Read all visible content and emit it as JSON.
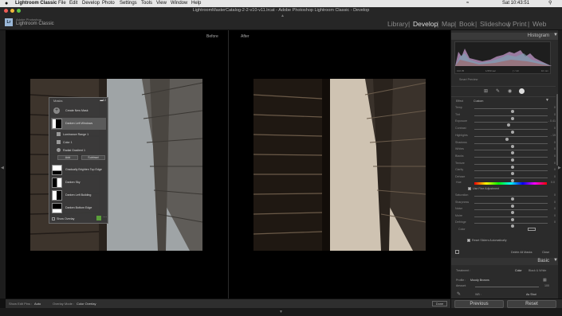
{
  "macbar": {
    "apple": "",
    "app": "Lightroom Classic",
    "menus": [
      "File",
      "Edit",
      "Develop",
      "Photo",
      "Settings",
      "Tools",
      "View",
      "Window",
      "Help"
    ],
    "clock": "Sat 10:43:51"
  },
  "window_title": "LightroomMasterCatalog-2-2-v10-v11.lrcat - Adobe Photoshop Lightroom Classic - Develop",
  "brand": {
    "line1": "Adobe Photoshop",
    "line2": "Lightroom Classic"
  },
  "modules": [
    {
      "label": "Library"
    },
    {
      "label": "Develop"
    },
    {
      "label": "Map"
    },
    {
      "label": "Book"
    },
    {
      "label": "Slideshow"
    },
    {
      "label": "Print"
    },
    {
      "label": "Web"
    }
  ],
  "module_sep": "|",
  "view": {
    "before": "Before",
    "after": "After"
  },
  "masks": {
    "title": "Masks",
    "create": "Create New Mask",
    "mask_name": "Darken Left Windows",
    "components": [
      "Luminance Range 1",
      "Color 1",
      "Radial Gradient 1"
    ],
    "add": "Add",
    "subtract": "Subtract",
    "others": [
      "Gradually Brighten Top Edge",
      "Darken Sky",
      "Darken Left Building",
      "Darken Bottom Edge"
    ],
    "show_overlay": "Show Overlay"
  },
  "histogram": {
    "title": "Histogram",
    "readout": [
      "102.35",
      "1/250 sec",
      "ƒ / 10",
      "10 mm"
    ],
    "smart_preview": "Smart Preview"
  },
  "effect": {
    "label": "Effect",
    "value": "Custom"
  },
  "sliders": [
    {
      "label": "Temp",
      "value": "0",
      "pos": 0.5
    },
    {
      "label": "Tint",
      "value": "0",
      "pos": 0.5
    },
    {
      "label": "Exposure",
      "value": "- 0.41",
      "pos": 0.45
    },
    {
      "label": "Contrast",
      "value": "0",
      "pos": 0.5
    },
    {
      "label": "Highlights",
      "value": "- 19",
      "pos": 0.42
    },
    {
      "label": "Shadows",
      "value": "0",
      "pos": 0.5
    },
    {
      "label": "Whites",
      "value": "0",
      "pos": 0.5
    },
    {
      "label": "Blacks",
      "value": "0",
      "pos": 0.5
    },
    {
      "label": "Texture",
      "value": "0",
      "pos": 0.5
    },
    {
      "label": "Clarity",
      "value": "0",
      "pos": 0.5
    },
    {
      "label": "Dehaze",
      "value": "0",
      "pos": 0.5
    }
  ],
  "hue": {
    "label": "Hue",
    "value": "0.0",
    "fine": "Use Fine Adjustment"
  },
  "sliders2": [
    {
      "label": "Saturation",
      "value": "0",
      "pos": 0.5
    },
    {
      "label": "Sharpness",
      "value": "0",
      "pos": 0.5
    },
    {
      "label": "Noise",
      "value": "0",
      "pos": 0.5
    },
    {
      "label": "Moire",
      "value": "0",
      "pos": 0.5
    },
    {
      "label": "Defringe",
      "value": "0",
      "pos": 0.5
    }
  ],
  "color_label": "Color",
  "reset_sliders": "Reset Sliders Automatically",
  "delete_all": "Delete All Masks",
  "close": "Close",
  "basic": {
    "title": "Basic",
    "treatment": "Treatment :",
    "color": "Color",
    "bw": "Black & White",
    "profile_label": "Profile :",
    "profile": "Moody Browns",
    "amount_label": "Amount",
    "amount": "100",
    "wb": "WB :",
    "as_shot": "As Shot"
  },
  "bottom": {
    "show_pins_label": "Show Edit Pins :",
    "show_pins": "Auto",
    "overlay_mode_label": "Overlay Mode :",
    "overlay_mode": "Color Overlay",
    "done": "Done"
  },
  "actions": {
    "previous": "Previous",
    "reset": "Reset"
  },
  "colors": {
    "accent": "#5a9f3a",
    "panel": "#2b2b2b",
    "bg": "#000000"
  }
}
